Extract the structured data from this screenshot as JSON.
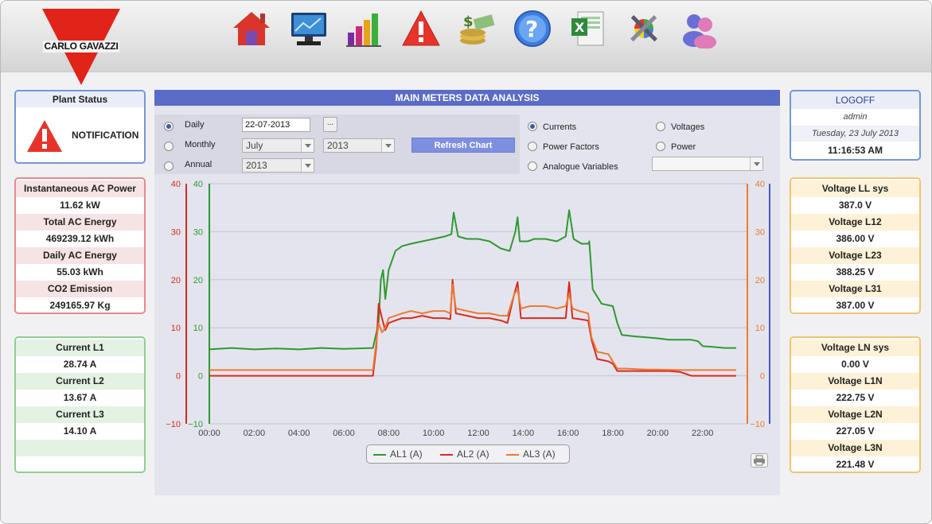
{
  "brand": {
    "logo_text": "CARLO GAVAZZI",
    "logo_color": "#e2231a"
  },
  "nav": [
    {
      "icon": "home-icon"
    },
    {
      "icon": "monitor-icon"
    },
    {
      "icon": "bar-chart-icon"
    },
    {
      "icon": "warning-icon"
    },
    {
      "icon": "money-icon"
    },
    {
      "icon": "help-icon"
    },
    {
      "icon": "excel-icon"
    },
    {
      "icon": "tools-icon"
    },
    {
      "icon": "users-icon"
    }
  ],
  "plant_status": {
    "title": "Plant Status",
    "notification": "NOTIFICATION"
  },
  "ac_power": {
    "rows": [
      {
        "label": "Instantaneous AC Power",
        "value": "11.62 kW"
      },
      {
        "label": "Total AC Energy",
        "value": "469239.12 kWh"
      },
      {
        "label": "Daily AC Energy",
        "value": "55.03 kWh"
      },
      {
        "label": "CO2 Emission",
        "value": "249165.97 Kg"
      }
    ]
  },
  "currents": {
    "rows": [
      {
        "label": "Current L1",
        "value": "28.74 A"
      },
      {
        "label": "Current L2",
        "value": "13.67 A"
      },
      {
        "label": "Current L3",
        "value": "14.10 A"
      }
    ]
  },
  "main": {
    "title": "MAIN METERS DATA ANALYSIS",
    "daily_label": "Daily",
    "monthly_label": "Monthly",
    "annual_label": "Annual",
    "date_value": "22-07-2013",
    "calendar_label": "...",
    "month_value": "July",
    "month_year_value": "2013",
    "annual_year_value": "2013",
    "refresh_label": "Refresh Chart",
    "currents_label": "Currents",
    "voltages_label": "Voltages",
    "power_factors_label": "Power Factors",
    "power_label": "Power",
    "analogue_label": "Analogue Variables",
    "analogue_value": ""
  },
  "user": {
    "logoff": "LOGOFF",
    "name": "admin",
    "date": "Tuesday, 23 July 2013",
    "time": "11:16:53 AM"
  },
  "voltage_ll": {
    "rows": [
      {
        "label": "Voltage LL sys",
        "value": "387.0 V"
      },
      {
        "label": "Voltage L12",
        "value": "386.00 V"
      },
      {
        "label": "Voltage L23",
        "value": "388.25 V"
      },
      {
        "label": "Voltage L31",
        "value": "387.00 V"
      }
    ]
  },
  "voltage_ln": {
    "rows": [
      {
        "label": "Voltage LN sys",
        "value": "0.00 V"
      },
      {
        "label": "Voltage L1N",
        "value": "222.75 V"
      },
      {
        "label": "Voltage L2N",
        "value": "227.05 V"
      },
      {
        "label": "Voltage L3N",
        "value": "221.48 V"
      }
    ]
  },
  "chart_data": {
    "type": "line",
    "ylim": [
      -10,
      40
    ],
    "yticks": [
      "40",
      "30",
      "20",
      "10",
      "0",
      "−10"
    ],
    "xticks": [
      "00:00",
      "02:00",
      "04:00",
      "06:00",
      "08:00",
      "10:00",
      "12:00",
      "14:00",
      "16:00",
      "18:00",
      "20:00",
      "22:00"
    ],
    "grid": true,
    "legend_position": "bottom",
    "series": [
      {
        "name": "AL1 (A)",
        "color": "#2e9a2e",
        "points": [
          [
            0,
            5.5
          ],
          [
            1,
            5.8
          ],
          [
            2,
            5.5
          ],
          [
            3,
            5.7
          ],
          [
            4,
            5.5
          ],
          [
            5,
            5.8
          ],
          [
            6,
            5.6
          ],
          [
            7.3,
            5.8
          ],
          [
            7.55,
            11
          ],
          [
            7.65,
            20
          ],
          [
            7.75,
            22
          ],
          [
            7.85,
            16
          ],
          [
            8.0,
            22
          ],
          [
            8.3,
            26
          ],
          [
            8.6,
            27
          ],
          [
            9,
            27.5
          ],
          [
            9.5,
            28
          ],
          [
            10,
            28.5
          ],
          [
            10.5,
            29
          ],
          [
            10.8,
            29.5
          ],
          [
            10.9,
            34
          ],
          [
            11.1,
            29
          ],
          [
            11.5,
            28.5
          ],
          [
            12,
            28.5
          ],
          [
            12.5,
            28
          ],
          [
            13,
            26.5
          ],
          [
            13.4,
            26
          ],
          [
            13.65,
            30
          ],
          [
            13.75,
            33
          ],
          [
            13.85,
            28
          ],
          [
            14.2,
            28
          ],
          [
            14.5,
            28.5
          ],
          [
            15,
            28.5
          ],
          [
            15.5,
            28
          ],
          [
            15.9,
            29
          ],
          [
            16.05,
            34.5
          ],
          [
            16.25,
            28.5
          ],
          [
            16.6,
            27.5
          ],
          [
            16.9,
            27.5
          ],
          [
            16.95,
            28
          ],
          [
            17.1,
            18
          ],
          [
            17.5,
            15
          ],
          [
            18,
            14.5
          ],
          [
            18.2,
            11
          ],
          [
            18.4,
            8.5
          ],
          [
            19,
            8.2
          ],
          [
            19.5,
            8
          ],
          [
            20,
            7.8
          ],
          [
            20.5,
            7.5
          ],
          [
            21,
            7.5
          ],
          [
            21.5,
            7.5
          ],
          [
            21.8,
            7.2
          ],
          [
            22,
            6.2
          ],
          [
            22.5,
            6
          ],
          [
            23,
            5.8
          ],
          [
            23.5,
            5.8
          ]
        ]
      },
      {
        "name": "AL2 (A)",
        "color": "#d92b1e",
        "points": [
          [
            0,
            0
          ],
          [
            7.3,
            0
          ],
          [
            7.45,
            6
          ],
          [
            7.55,
            15
          ],
          [
            7.7,
            12
          ],
          [
            7.85,
            9.5
          ],
          [
            8.0,
            11
          ],
          [
            8.3,
            11.5
          ],
          [
            8.6,
            12
          ],
          [
            9,
            12
          ],
          [
            9.5,
            12.5
          ],
          [
            10,
            12
          ],
          [
            10.5,
            12
          ],
          [
            10.75,
            11.8
          ],
          [
            10.85,
            20
          ],
          [
            11,
            13
          ],
          [
            11.5,
            12.5
          ],
          [
            12,
            12
          ],
          [
            12.5,
            12
          ],
          [
            13,
            11.5
          ],
          [
            13.3,
            11
          ],
          [
            13.6,
            17
          ],
          [
            13.75,
            19.5
          ],
          [
            13.9,
            12
          ],
          [
            14.3,
            12
          ],
          [
            15,
            12
          ],
          [
            15.5,
            12
          ],
          [
            15.9,
            12
          ],
          [
            16.05,
            19.5
          ],
          [
            16.2,
            12
          ],
          [
            16.5,
            11.8
          ],
          [
            16.9,
            11.5
          ],
          [
            17.05,
            7.5
          ],
          [
            17.3,
            3.5
          ],
          [
            17.8,
            3
          ],
          [
            18.0,
            2.5
          ],
          [
            18.2,
            1
          ],
          [
            18.5,
            1
          ],
          [
            19.5,
            1
          ],
          [
            20,
            1
          ],
          [
            20.5,
            1
          ],
          [
            21,
            0.8
          ],
          [
            21.5,
            0
          ],
          [
            22,
            0
          ],
          [
            22.5,
            0
          ],
          [
            23.5,
            0
          ]
        ]
      },
      {
        "name": "AL3 (A)",
        "color": "#ec7a30",
        "points": [
          [
            0,
            1.2
          ],
          [
            7.3,
            1.2
          ],
          [
            7.45,
            7
          ],
          [
            7.55,
            11
          ],
          [
            7.7,
            9
          ],
          [
            7.85,
            10
          ],
          [
            8.0,
            12
          ],
          [
            8.3,
            12.5
          ],
          [
            8.6,
            13
          ],
          [
            9,
            13.5
          ],
          [
            9.5,
            13
          ],
          [
            10,
            13.5
          ],
          [
            10.5,
            13.5
          ],
          [
            10.75,
            13
          ],
          [
            10.85,
            19
          ],
          [
            11,
            14
          ],
          [
            11.5,
            13.5
          ],
          [
            12,
            13
          ],
          [
            12.5,
            13
          ],
          [
            13,
            12.5
          ],
          [
            13.3,
            12.5
          ],
          [
            13.6,
            17
          ],
          [
            13.75,
            18
          ],
          [
            13.9,
            14
          ],
          [
            14.3,
            14.5
          ],
          [
            15,
            14.5
          ],
          [
            15.5,
            14
          ],
          [
            15.9,
            14.5
          ],
          [
            16.05,
            17
          ],
          [
            16.2,
            14
          ],
          [
            16.5,
            13.5
          ],
          [
            16.9,
            13
          ],
          [
            17.05,
            8
          ],
          [
            17.3,
            5
          ],
          [
            17.8,
            4.5
          ],
          [
            18.0,
            3
          ],
          [
            18.2,
            1.5
          ],
          [
            18.5,
            1.5
          ],
          [
            19.5,
            1.3
          ],
          [
            20,
            1.3
          ],
          [
            21,
            1.2
          ],
          [
            22,
            1.2
          ],
          [
            22.5,
            1.2
          ],
          [
            23.5,
            1.2
          ]
        ]
      }
    ]
  }
}
